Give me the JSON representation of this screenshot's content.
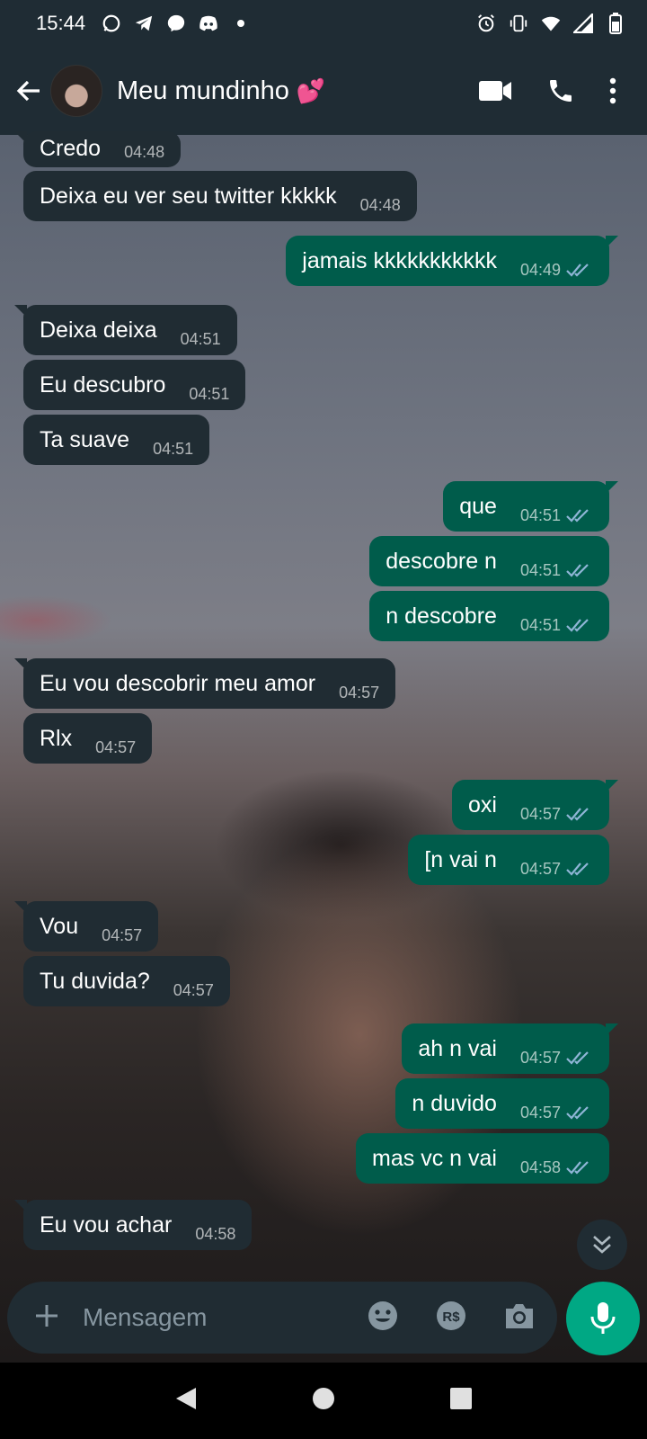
{
  "status_bar": {
    "time": "15:44"
  },
  "header": {
    "contact_name": "Meu mundinho",
    "name_emoji": "💕"
  },
  "messages": [
    {
      "dir": "in",
      "text": "Credo",
      "time": "04:48"
    },
    {
      "dir": "in",
      "text": "Deixa eu ver seu twitter kkkkk",
      "time": "04:48"
    },
    {
      "dir": "out",
      "text": "jamais kkkkkkkkkkk",
      "time": "04:49"
    },
    {
      "dir": "in",
      "text": "Deixa deixa",
      "time": "04:51"
    },
    {
      "dir": "in",
      "text": "Eu descubro",
      "time": "04:51"
    },
    {
      "dir": "in",
      "text": "Ta suave",
      "time": "04:51"
    },
    {
      "dir": "out",
      "text": "que",
      "time": "04:51"
    },
    {
      "dir": "out",
      "text": "descobre n",
      "time": "04:51"
    },
    {
      "dir": "out",
      "text": "n descobre",
      "time": "04:51"
    },
    {
      "dir": "in",
      "text": "Eu vou descobrir meu amor",
      "time": "04:57"
    },
    {
      "dir": "in",
      "text": "Rlx",
      "time": "04:57"
    },
    {
      "dir": "out",
      "text": "oxi",
      "time": "04:57"
    },
    {
      "dir": "out",
      "text": "[n vai n",
      "time": "04:57"
    },
    {
      "dir": "in",
      "text": "Vou",
      "time": "04:57"
    },
    {
      "dir": "in",
      "text": "Tu duvida?",
      "time": "04:57"
    },
    {
      "dir": "out",
      "text": "ah n vai",
      "time": "04:57"
    },
    {
      "dir": "out",
      "text": "n duvido",
      "time": "04:57"
    },
    {
      "dir": "out",
      "text": "mas vc n vai",
      "time": "04:58"
    },
    {
      "dir": "in",
      "text": "Eu vou achar",
      "time": "04:58"
    }
  ],
  "input": {
    "placeholder": "Mensagem"
  },
  "colors": {
    "header_bg": "#1f2c34",
    "incoming_bubble": "#202c33",
    "outgoing_bubble": "#005c4b",
    "accent_green": "#00a884",
    "read_ticks": "#8fb5d6"
  }
}
